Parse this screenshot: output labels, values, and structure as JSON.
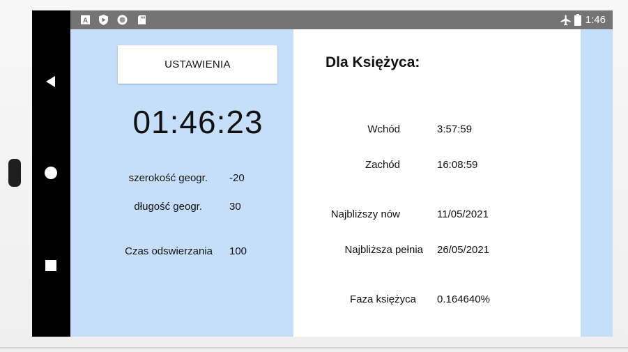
{
  "status_bar": {
    "time": "1:46",
    "icons": [
      "app-a-icon",
      "play-protect-icon",
      "circle-icon",
      "sd-card-icon",
      "airplane-icon",
      "battery-icon"
    ]
  },
  "nav_bar": {
    "back": "back-icon",
    "home": "home-icon",
    "recent": "recent-apps-icon"
  },
  "left": {
    "settings_button": "USTAWIENIA",
    "clock": "01:46:23",
    "rows": [
      {
        "label": "szerokość geogr.",
        "value": "-20"
      },
      {
        "label": "długość geogr.",
        "value": "30"
      },
      {
        "label": "Czas odswierzania",
        "value": "100"
      }
    ]
  },
  "right": {
    "title": "Dla Księżyca:",
    "rows": [
      {
        "label": "Wchód",
        "value": "3:57:59"
      },
      {
        "label": "Zachód",
        "value": "16:08:59"
      },
      {
        "label": "Najbliższy nów",
        "value": "11/05/2021"
      },
      {
        "label": "Najbliższa pełnia",
        "value": "26/05/2021"
      },
      {
        "label": "Faza księżyca",
        "value": "0.164640%"
      }
    ]
  },
  "colors": {
    "panel_blue": "#c5dffb",
    "status_bar": "#747474",
    "nav_bar": "#000000"
  }
}
